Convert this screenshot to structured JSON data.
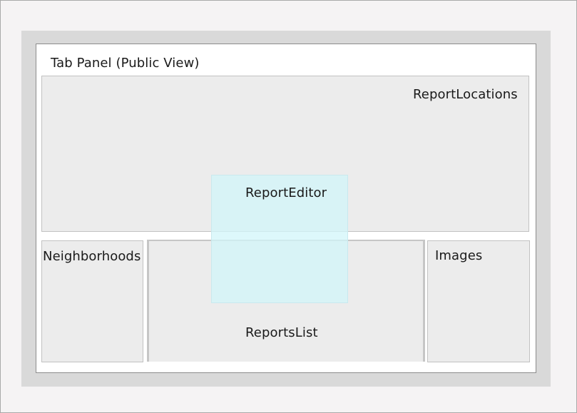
{
  "panel": {
    "title": "Tab Panel (Public View)"
  },
  "regions": {
    "report_locations": "ReportLocations",
    "report_editor": "ReportEditor",
    "neighborhoods": "Neighborhoods",
    "reports_list": "ReportsList",
    "images": "Images"
  }
}
